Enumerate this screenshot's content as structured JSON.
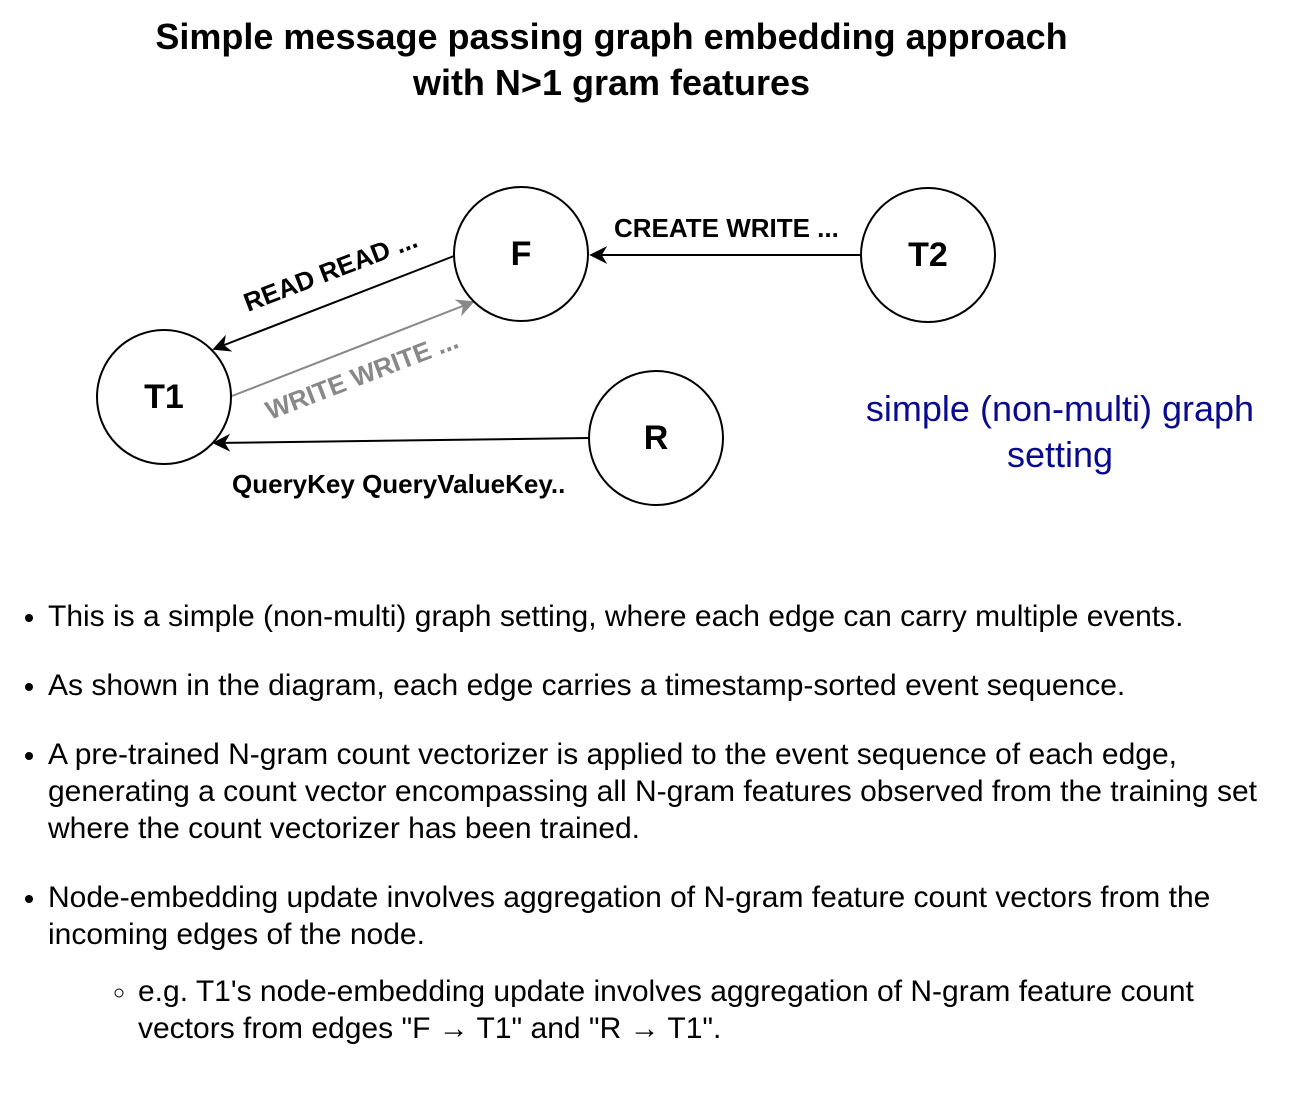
{
  "title": "Simple message passing graph embedding approach\nwith N>1 gram features",
  "diagram": {
    "nodes": [
      {
        "id": "T1",
        "label": "T1"
      },
      {
        "id": "F",
        "label": "F"
      },
      {
        "id": "T2",
        "label": "T2"
      },
      {
        "id": "R",
        "label": "R"
      }
    ],
    "edges": [
      {
        "from": "F",
        "to": "T1",
        "label": "READ READ ...",
        "color": "#000000"
      },
      {
        "from": "T1",
        "to": "F",
        "label": "WRITE WRITE ...",
        "color": "#888888"
      },
      {
        "from": "T2",
        "to": "F",
        "label": "CREATE WRITE ...",
        "color": "#000000"
      },
      {
        "from": "R",
        "to": "T1",
        "label": "QueryKey QueryValueKey..",
        "color": "#000000"
      }
    ],
    "side_note": "simple (non-multi) graph\nsetting",
    "side_note_color": "#0a0a8f"
  },
  "bullets": [
    "This is a simple (non-multi) graph setting, where each edge can carry multiple events.",
    "As shown in the diagram, each edge carries a timestamp-sorted event sequence.",
    "A pre-trained N-gram count vectorizer is applied to the event sequence of each edge, generating a count vector encompassing all N-gram features observed from the training set where the count vectorizer has been trained.",
    "Node-embedding update involves aggregation of N-gram feature count vectors from the incoming edges of the node."
  ],
  "sub_bullets": [
    "e.g. T1's node-embedding update involves aggregation of N-gram feature count vectors from edges \"F → T1\" and \"R → T1\"."
  ]
}
